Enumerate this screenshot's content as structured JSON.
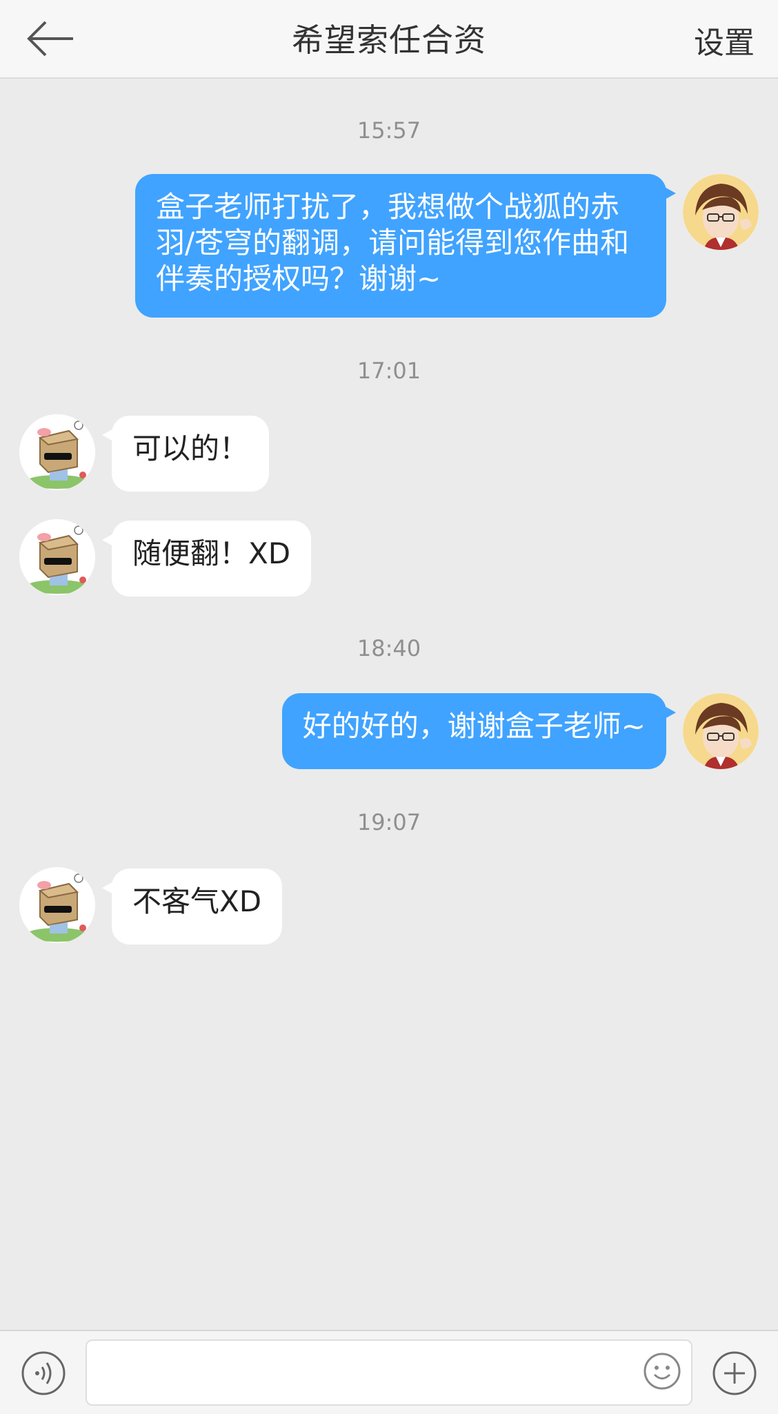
{
  "header": {
    "back_icon": "arrow-left-icon",
    "title": "希望索任合资",
    "settings_label": "设置"
  },
  "messages": [
    {
      "type": "timestamp",
      "text": "15:57"
    },
    {
      "type": "sent",
      "text": "盒子老师打扰了，我想做个战狐的赤羽/苍穹的翻调，请问能得到您作曲和伴奏的授权吗？谢谢~"
    },
    {
      "type": "timestamp",
      "text": "17:01"
    },
    {
      "type": "received",
      "text": "可以的！"
    },
    {
      "type": "received",
      "text": "随便翻！XD"
    },
    {
      "type": "timestamp",
      "text": "18:40"
    },
    {
      "type": "sent",
      "text": "好的好的，谢谢盒子老师~"
    },
    {
      "type": "timestamp",
      "text": "19:07"
    },
    {
      "type": "received",
      "text": "不客气XD"
    }
  ],
  "input_bar": {
    "voice_icon": "voice-icon",
    "input_value": "",
    "emoji_icon": "emoji-icon",
    "plus_icon": "plus-icon"
  },
  "colors": {
    "sent_bubble": "#40a3ff",
    "received_bubble": "#ffffff",
    "background": "#ebebeb"
  }
}
